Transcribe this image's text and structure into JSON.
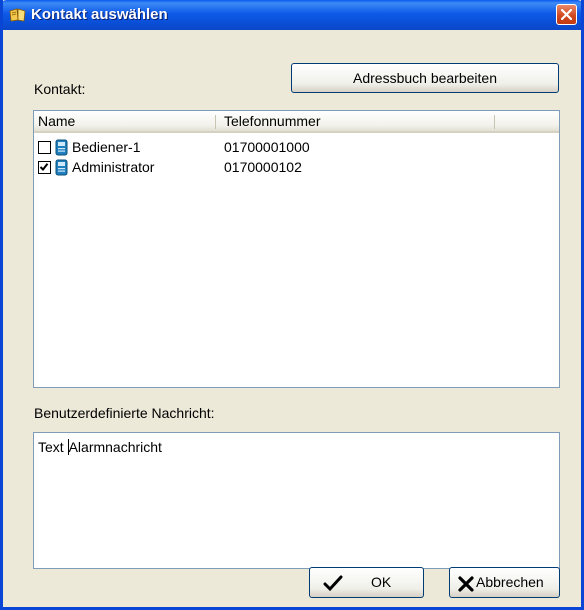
{
  "window": {
    "title": "Kontakt auswählen"
  },
  "contact_section": {
    "label": "Kontakt:",
    "edit_button": "Adressbuch bearbeiten"
  },
  "list": {
    "columns": [
      "Name",
      "Telefonnummer"
    ],
    "rows": [
      {
        "name": "Bediener-1",
        "phone": "01700001000",
        "checked": false
      },
      {
        "name": "Administrator",
        "phone": "0170000102",
        "checked": true
      }
    ]
  },
  "message_section": {
    "label": "Benutzerdefinierte Nachricht:",
    "value_before_caret": "Text ",
    "value_after_caret": "Alarmnachricht"
  },
  "buttons": {
    "ok": "OK",
    "cancel": "Abbrechen"
  },
  "colors": {
    "titlebar": "#0a4fd7",
    "window_bg": "#ece9d8",
    "close": "#d24a21",
    "border": "#7f9db9"
  }
}
